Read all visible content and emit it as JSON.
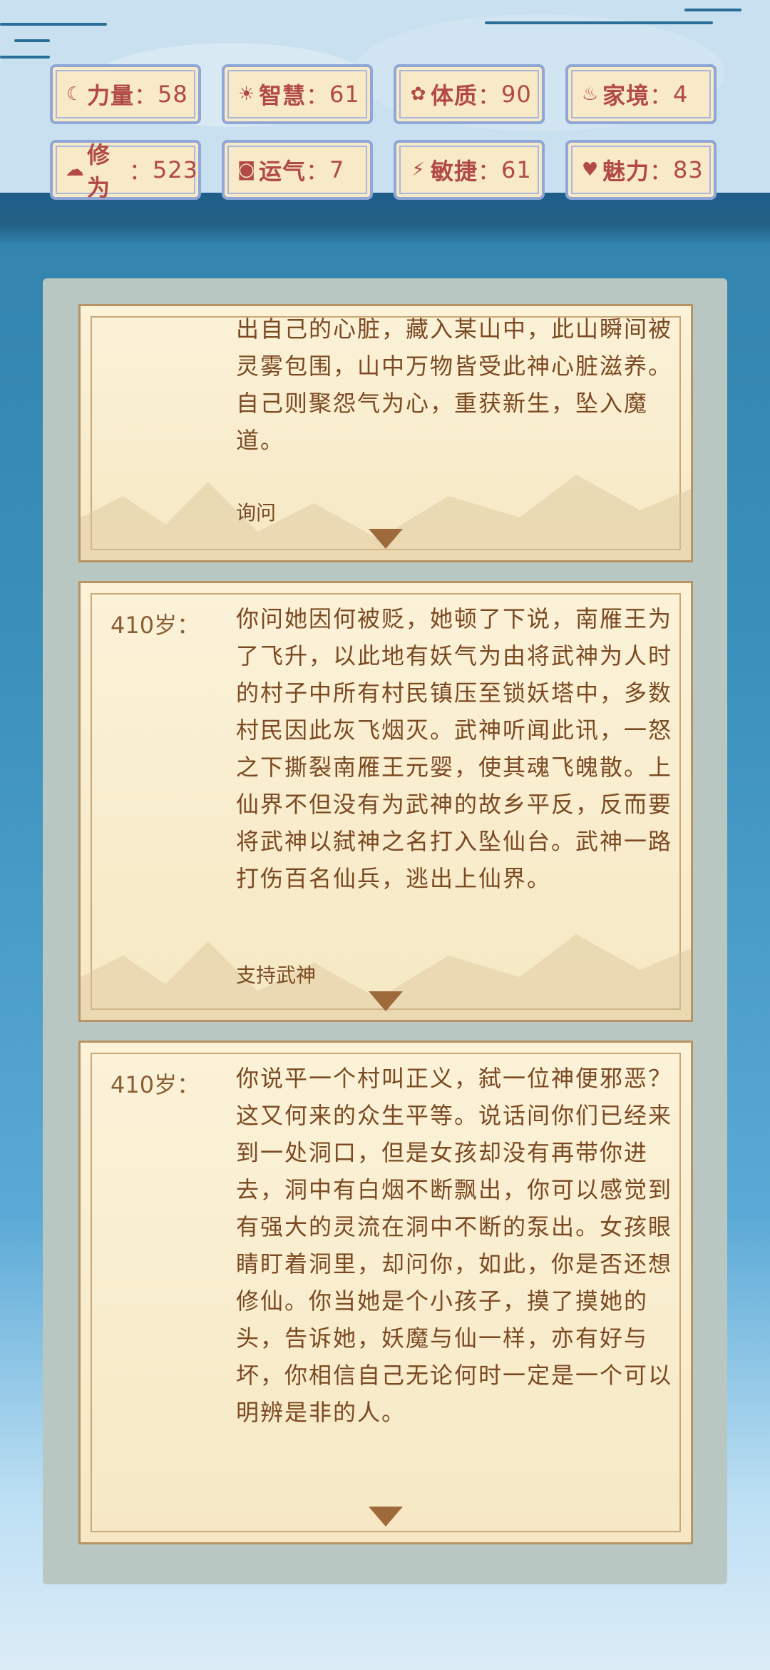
{
  "stats": [
    {
      "icon": "strength-icon",
      "glyph": "☾",
      "label": "力量",
      "sep": "：",
      "value": "58"
    },
    {
      "icon": "wisdom-icon",
      "glyph": "☀",
      "label": "智慧",
      "sep": "：",
      "value": "61"
    },
    {
      "icon": "constitution-icon",
      "glyph": "✿",
      "label": "体质",
      "sep": "：",
      "value": "90"
    },
    {
      "icon": "family-icon",
      "glyph": "♨",
      "label": "家境",
      "sep": "：",
      "value": "4"
    },
    {
      "icon": "cultivation-icon",
      "glyph": "☁",
      "label": "修为",
      "sep": "：",
      "value": "523"
    },
    {
      "icon": "luck-icon",
      "glyph": "◙",
      "label": "运气",
      "sep": "：",
      "value": "7"
    },
    {
      "icon": "agility-icon",
      "glyph": "⚡",
      "label": "敏捷",
      "sep": "：",
      "value": "61"
    },
    {
      "icon": "charm-icon",
      "glyph": "♥",
      "label": "魅力",
      "sep": "：",
      "value": "83"
    }
  ],
  "events": [
    {
      "age": "",
      "text": "出自己的心脏，藏入某山中，此山瞬间被灵雾包围，山中万物皆受此神心脏滋养。自己则聚怨气为心，重获新生，坠入魔道。",
      "option": "询问"
    },
    {
      "age": "410岁：",
      "text": "你问她因何被贬，她顿了下说，南雁王为了飞升，以此地有妖气为由将武神为人时的村子中所有村民镇压至锁妖塔中，多数村民因此灰飞烟灭。武神听闻此讯，一怒之下撕裂南雁王元婴，使其魂飞魄散。上仙界不但没有为武神的故乡平反，反而要将武神以弑神之名打入坠仙台。武神一路打伤百名仙兵，逃出上仙界。",
      "option": "支持武神"
    },
    {
      "age": "410岁：",
      "text": "你说平一个村叫正义，弑一位神便邪恶？这又何来的众生平等。说话间你们已经来到一处洞口，但是女孩却没有再带你进去，洞中有白烟不断飘出，你可以感觉到有强大的灵流在洞中不断的泵出。女孩眼睛盯着洞里，却问你，如此，你是否还想修仙。你当她是个小孩子，摸了摸她的头，告诉她，妖魔与仙一样，亦有好与坏，你相信自己无论何时一定是一个可以明辨是非的人。",
      "option": ""
    }
  ]
}
